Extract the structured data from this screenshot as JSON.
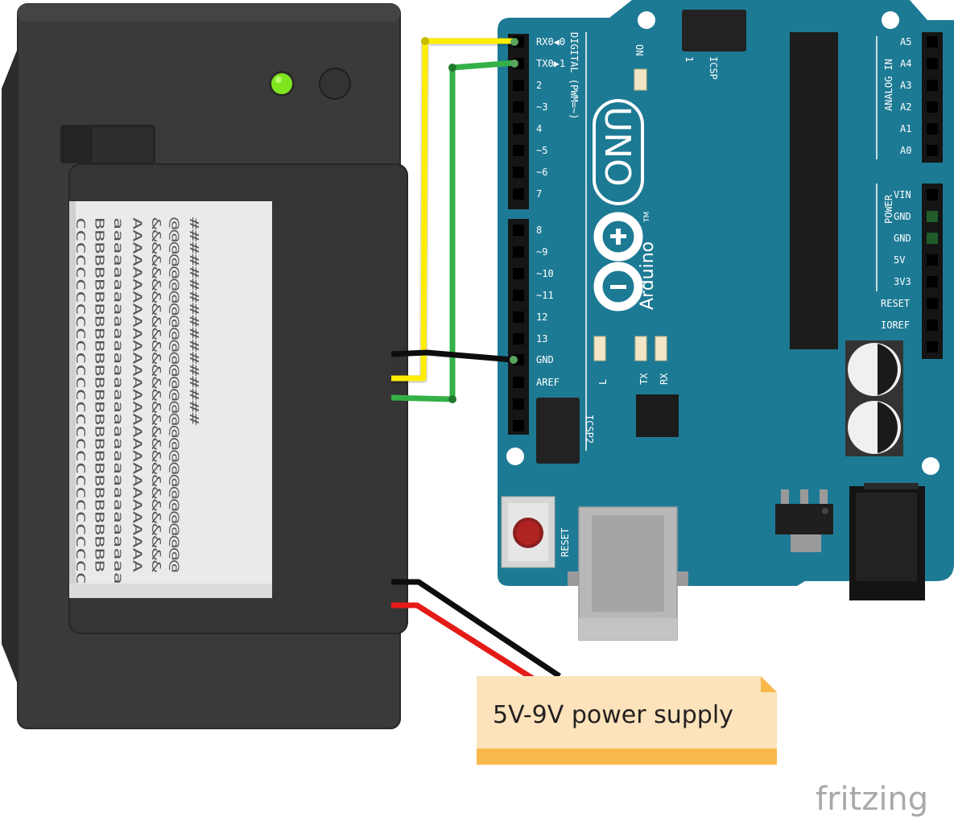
{
  "printer": {
    "paper_columns": [
      "CCCCCCCCCCCCCCCCCCCCCCCCCCCCCC",
      "BBBBBBBBBBBBBBBBBBBBBBBBBBBBB",
      "aaaaaaaaaaaaaaaaaaaaaaaaaaaaaa",
      "AAAAAAAAAAAAAAAAAAAAAAAAAAAAA",
      "&&&&&&&&&&&&&&&&&&&&&&&&&&&&&",
      "@@@@@@@@@@@@@@@@@@@@@@@@@@@@@",
      "#################"
    ]
  },
  "arduino": {
    "digital_pins": [
      {
        "label": "RX0◀0"
      },
      {
        "label": "TX0▶1"
      },
      {
        "label": "2"
      },
      {
        "label": "~3"
      },
      {
        "label": "4"
      },
      {
        "label": "~5"
      },
      {
        "label": "~6"
      },
      {
        "label": "7"
      },
      {
        "label": "8"
      },
      {
        "label": "~9"
      },
      {
        "label": "~10"
      },
      {
        "label": "~11"
      },
      {
        "label": "12"
      },
      {
        "label": "13"
      },
      {
        "label": "GND"
      },
      {
        "label": "AREF"
      }
    ],
    "digital_header_label": "DIGITAL (PWM=~)",
    "analog_pins": [
      "A5",
      "A4",
      "A3",
      "A2",
      "A1",
      "A0"
    ],
    "analog_header_label": "ANALOG IN",
    "power_pins": [
      "VIN",
      "GND",
      "GND",
      "5V",
      "3V3",
      "RESET",
      "IOREF"
    ],
    "power_header_label": "POWER",
    "on_label": "ON",
    "icsp_label": "ICSP",
    "icsp_pin1_label": "1",
    "icsp2_label": "ICSP2",
    "led_labels": [
      "L",
      "TX",
      "RX"
    ],
    "model_label": "UNO",
    "brand_label": "Arduino",
    "trademark": "TM",
    "reset_label": "RESET"
  },
  "note": {
    "text": "5V-9V power supply"
  },
  "watermark": "fritzing",
  "colors": {
    "board": "#1d7a94",
    "wire_yellow": "#ffee00",
    "wire_green": "#34b047",
    "wire_black": "#0d0d0d",
    "wire_red": "#e41b17",
    "printer_body": "#3a3a3a",
    "note_fill": "#fce3bb",
    "note_band": "#f9b94a",
    "status_led": "#7fe51f"
  }
}
